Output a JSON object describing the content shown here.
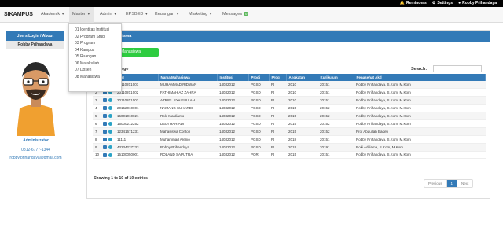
{
  "topbar": {
    "reminders": "Reminders",
    "settings": "Settings",
    "user": "Robby Prihandaya"
  },
  "navbar": {
    "brand": "SIKAMPUS",
    "items": [
      {
        "label": "Akademik",
        "icon": "caret-down-icon"
      },
      {
        "label": "Master",
        "icon": "caret-down-icon"
      },
      {
        "label": "Admin",
        "icon": "caret-down-icon"
      },
      {
        "label": "EPSBED",
        "icon": "caret-down-icon"
      },
      {
        "label": "Keuangan",
        "icon": "caret-down-icon"
      },
      {
        "label": "Marketing",
        "icon": "caret-down-icon"
      },
      {
        "label": "Messages",
        "badge": "0"
      }
    ]
  },
  "dropdown": {
    "items": [
      "01 Identitas Institusi",
      "02 Program Studi",
      "03 Program",
      "04 Kampus",
      "05 Ruangan",
      "06 Matakuliah",
      "07 Dosen",
      "08 Mahasiswa"
    ]
  },
  "sidebar": {
    "title": "Users Login / About",
    "name": "Robby Prihandaya",
    "role": "Administrator",
    "phone": "0812-6777-1344",
    "email": "robby.prihandaya@gmail.com"
  },
  "main": {
    "title": "Master Mahasiswa",
    "add_button": "Mahasiswa",
    "show_label": "ecords per page",
    "search_label": "Search:",
    "columns": [
      "No",
      "Action",
      "NIM",
      "Nama Mahasiswa",
      "Institusi",
      "Prodi",
      "Prog",
      "Angkatan",
      "Kurikulum",
      "Penasehat Akd"
    ],
    "rows": [
      [
        "1",
        "",
        "20110201001",
        "MUHAMMAD RIDWAN",
        "14032012",
        "PGSD",
        "R",
        "2010",
        "20151",
        "Robby Prihandaya, S.Kom, M.Kom"
      ],
      [
        "2",
        "",
        "20110201002",
        "FATHIMAH AZ ZAHRA",
        "14032012",
        "PGSD",
        "R",
        "2010",
        "20151",
        "Robby Prihandaya, S.Kom, M.Kom"
      ],
      [
        "3",
        "",
        "20110201003",
        "AZRIEL SYAIFULLAH",
        "14032012",
        "PGSD",
        "R",
        "2010",
        "20151",
        "Robby Prihandaya, S.Kom, M.Kom"
      ],
      [
        "4",
        "",
        "20152010001",
        "NAMANG SUHARDI",
        "14032012",
        "PGSD",
        "R",
        "2015",
        "20152",
        "Robby Prihandaya, S.Kom, M.Kom"
      ],
      [
        "5",
        "",
        "15001010021",
        "Roki Mardianto",
        "14032012",
        "PGSD",
        "R",
        "2015",
        "20152",
        "Robby Prihandaya, S.Kom, M.Kom"
      ],
      [
        "6",
        "",
        "15000212252",
        "DEDI HARIADI",
        "14032012",
        "PGSD",
        "R",
        "2015",
        "20152",
        "Robby Prihandaya, S.Kom, M.Kom"
      ],
      [
        "7",
        "",
        "12341671231",
        "Mahasiswa Contoh",
        "14032012",
        "PGSD",
        "R",
        "2015",
        "20152",
        "Prof Abdullah Badeh"
      ],
      [
        "8",
        "",
        "11111",
        "Muhammad Arenio",
        "14032012",
        "PGSD",
        "R",
        "2018",
        "20151",
        "Robby Prihandaya, S.Kom, M.Kom"
      ],
      [
        "9",
        "",
        "43234237233",
        "Robby Prihandaya",
        "14032012",
        "PGSD",
        "R",
        "2019",
        "20191",
        "Roki Adiliama, S.Kom, M.Kom"
      ],
      [
        "10",
        "",
        "15100050001",
        "ROLAND SAPUTRA",
        "14032012",
        "POR",
        "R",
        "2015",
        "20151",
        "Robby Prihandaya, S.Kom, M.Kom"
      ]
    ],
    "showing": "Showing 1 to 10 of 10 entries",
    "pager": {
      "prev": "Previous",
      "current": "1",
      "next": "Next"
    }
  },
  "colors": {
    "primary": "#337ab7",
    "success": "#2ecc40",
    "topbar": "#000000"
  }
}
